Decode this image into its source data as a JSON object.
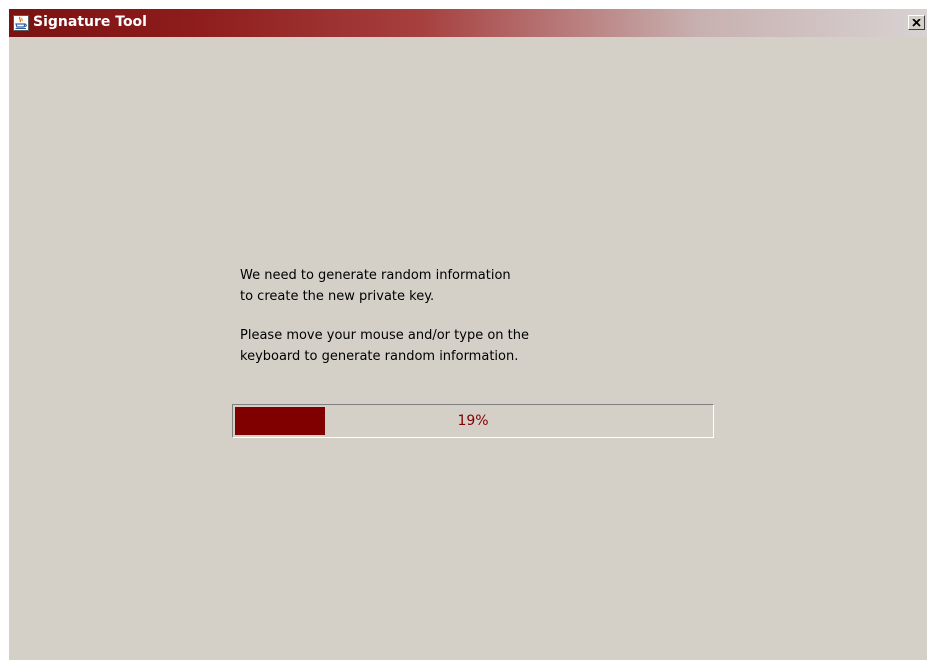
{
  "window": {
    "title": "Signature Tool",
    "app_icon": "java-cup-icon",
    "close_icon": "close-x-icon"
  },
  "message": {
    "line1": "We need to generate random information",
    "line2": "to create the new private key.",
    "line3": "Please move your mouse and/or type on the",
    "line4": "keyboard to generate random information."
  },
  "progress": {
    "value": 0.19,
    "label": "19%",
    "fill_color": "#800000"
  }
}
